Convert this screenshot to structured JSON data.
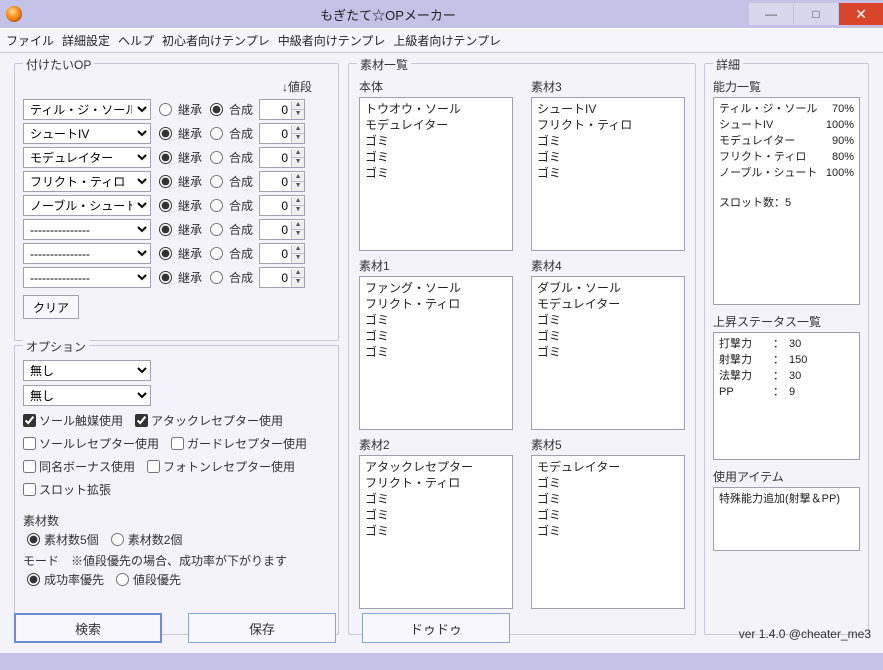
{
  "window": {
    "title": "もぎたて☆OPメーカー",
    "minimize": "—",
    "maximize": "□",
    "close": "✕"
  },
  "menu": [
    "ファイル",
    "詳細設定",
    "ヘルプ",
    "初心者向けテンプレ",
    "中級者向けテンプレ",
    "上級者向けテンプレ"
  ],
  "op_group": {
    "title": "付けたいOP",
    "header": "↓値段",
    "keisho": "継承",
    "gosei": "合成",
    "clear": "クリア",
    "rows": [
      {
        "sel": "ティル・ジ・ソール",
        "mode": "gosei",
        "val": "0"
      },
      {
        "sel": "シュートIV",
        "mode": "keisho",
        "val": "0"
      },
      {
        "sel": "モデュレイター",
        "mode": "keisho",
        "val": "0"
      },
      {
        "sel": "フリクト・ティロ",
        "mode": "keisho",
        "val": "0"
      },
      {
        "sel": "ノーブル・シュート",
        "mode": "keisho",
        "val": "0"
      },
      {
        "sel": "---------------",
        "mode": "keisho",
        "val": "0"
      },
      {
        "sel": "---------------",
        "mode": "keisho",
        "val": "0"
      },
      {
        "sel": "---------------",
        "mode": "keisho",
        "val": "0"
      }
    ]
  },
  "option_group": {
    "title": "オプション",
    "sel1": "無し",
    "sel2": "無し",
    "checks": [
      {
        "label": "ソール触媒使用",
        "checked": true
      },
      {
        "label": "アタックレセプター使用",
        "checked": true
      },
      {
        "label": "ソールレセプター使用",
        "checked": false
      },
      {
        "label": "ガードレセプター使用",
        "checked": false
      },
      {
        "label": "同名ボーナス使用",
        "checked": false
      },
      {
        "label": "フォトンレセプター使用",
        "checked": false
      },
      {
        "label": "スロット拡張",
        "checked": false
      }
    ],
    "sozaisu_label": "素材数",
    "sozaisu_5": "素材数5個",
    "sozaisu_2": "素材数2個",
    "mode_label": "モード",
    "mode_note": "※値段優先の場合、成功率が下がります",
    "mode_success": "成功率優先",
    "mode_price": "値段優先"
  },
  "materials": {
    "title": "素材一覧",
    "cells": [
      {
        "label": "本体",
        "lines": [
          "トウオウ・ソール",
          "モデュレイター",
          "ゴミ",
          "ゴミ",
          "ゴミ"
        ]
      },
      {
        "label": "素材3",
        "lines": [
          "シュートIV",
          "フリクト・ティロ",
          "ゴミ",
          "ゴミ",
          "ゴミ"
        ]
      },
      {
        "label": "素材1",
        "lines": [
          "ファング・ソール",
          "フリクト・ティロ",
          "ゴミ",
          "ゴミ",
          "ゴミ"
        ]
      },
      {
        "label": "素材4",
        "lines": [
          "ダブル・ソール",
          "モデュレイター",
          "ゴミ",
          "ゴミ",
          "ゴミ"
        ]
      },
      {
        "label": "素材2",
        "lines": [
          "アタックレセプター",
          "フリクト・ティロ",
          "ゴミ",
          "ゴミ",
          "ゴミ"
        ]
      },
      {
        "label": "素材5",
        "lines": [
          "モデュレイター",
          "ゴミ",
          "ゴミ",
          "ゴミ",
          "ゴミ"
        ]
      }
    ]
  },
  "detail": {
    "title": "詳細",
    "ability_label": "能力一覧",
    "abilities": [
      {
        "name": "ティル・ジ・ソール",
        "pct": "70%"
      },
      {
        "name": "シュートIV",
        "pct": "100%"
      },
      {
        "name": "モデュレイター",
        "pct": "90%"
      },
      {
        "name": "フリクト・ティロ",
        "pct": "80%"
      },
      {
        "name": "ノーブル・シュート",
        "pct": "100%"
      }
    ],
    "slot_line": "スロット数：5",
    "stats_label": "上昇ステータス一覧",
    "stats": [
      {
        "k": "打撃力",
        "v": "30"
      },
      {
        "k": "射撃力",
        "v": "150"
      },
      {
        "k": "法撃力",
        "v": "30"
      },
      {
        "k": "PP",
        "v": "9"
      }
    ],
    "items_label": "使用アイテム",
    "items_line": "特殊能力追加(射撃＆PP)"
  },
  "buttons": {
    "search": "検索",
    "save": "保存",
    "dudu": "ドゥドゥ"
  },
  "version": "ver 1.4.0  @cheater_me3"
}
